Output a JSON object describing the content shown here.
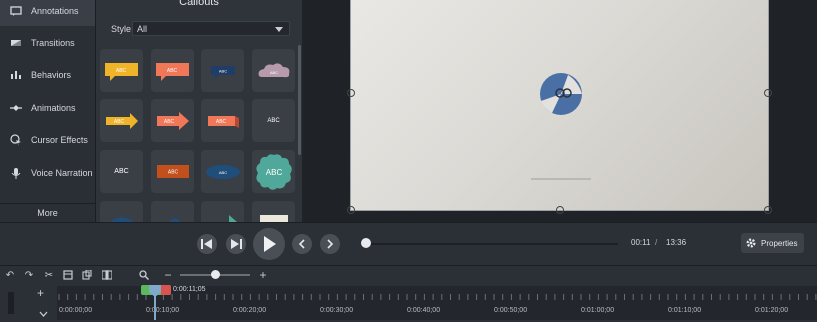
{
  "sidebar": {
    "items": [
      {
        "label": "Annotations",
        "icon": "annotation-icon"
      },
      {
        "label": "Transitions",
        "icon": "transition-icon"
      },
      {
        "label": "Behaviors",
        "icon": "behaviors-icon"
      },
      {
        "label": "Animations",
        "icon": "animation-icon"
      },
      {
        "label": "Cursor Effects",
        "icon": "cursor-icon"
      },
      {
        "label": "Voice Narration",
        "icon": "microphone-icon"
      }
    ],
    "more_label": "More"
  },
  "library": {
    "title": "Callouts",
    "style_label": "Style",
    "style_value": "All",
    "tiles": [
      {
        "text": "ABC",
        "kind": "yellow-speech"
      },
      {
        "text": "ABC",
        "kind": "orange-speech"
      },
      {
        "text": "ABC",
        "kind": "navy-speech"
      },
      {
        "text": "ABC",
        "kind": "cloud"
      },
      {
        "text": "ABC",
        "kind": "yellow-arrow"
      },
      {
        "text": "ABC",
        "kind": "orange-arrow"
      },
      {
        "text": "ABC",
        "kind": "orange-banner"
      },
      {
        "text": "ABC",
        "kind": "plain-text"
      },
      {
        "text": "ABC",
        "kind": "plain-text"
      },
      {
        "text": "ABC",
        "kind": "dark-orange-rect"
      },
      {
        "text": "ABC",
        "kind": "navy-oval"
      },
      {
        "text": "ABC",
        "kind": "teal-burst"
      }
    ]
  },
  "playback": {
    "current_time": "00:11",
    "separator": "/",
    "total_time": "13:36",
    "properties_label": "Properties"
  },
  "timeline": {
    "playhead_time": "0:00:11;05",
    "ticks": [
      "0:00:00;00",
      "0:00:10;00",
      "0:00:20;00",
      "0:00:30;00",
      "0:00:40;00",
      "0:00:50;00",
      "0:01:00;00",
      "0:01:10;00",
      "0:01:20;00"
    ]
  },
  "colors": {
    "accent_green": "#5cb85c",
    "playhead_blue": "#7fa8c9",
    "logo_blue": "#4a6fa5"
  }
}
